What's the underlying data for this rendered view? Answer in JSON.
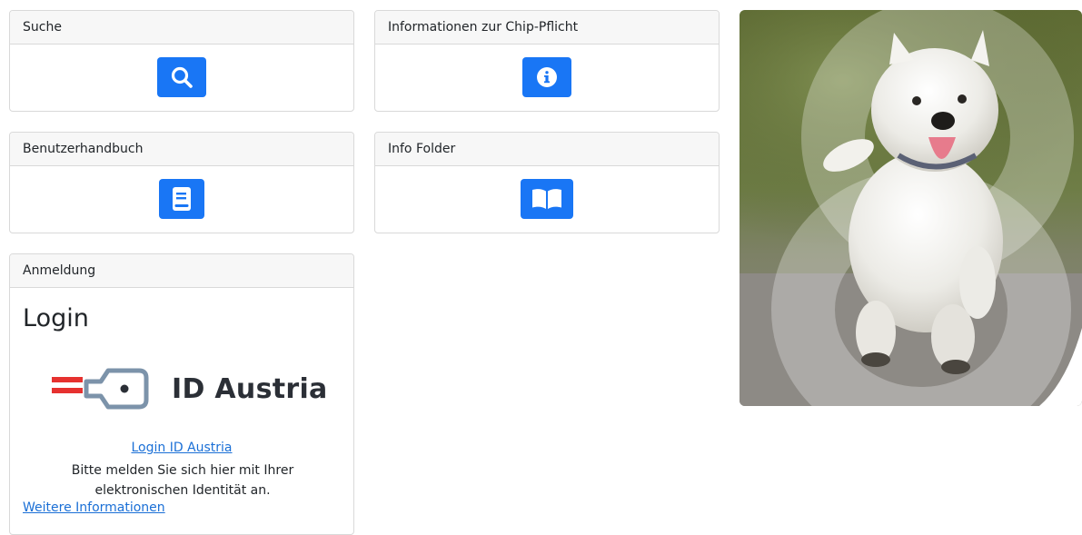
{
  "cards": {
    "search": {
      "header": "Suche",
      "icon": "search-icon"
    },
    "chip": {
      "header": "Informationen zur Chip-Pflicht",
      "icon": "info-icon"
    },
    "manual": {
      "header": "Benutzerhandbuch",
      "icon": "book-icon"
    },
    "folder": {
      "header": "Info Folder",
      "icon": "open-book-icon"
    }
  },
  "login": {
    "header": "Anmeldung",
    "title": "Login",
    "logo_text": "ID Austria",
    "link": "Login ID Austria",
    "description": "Bitte melden Sie sich hier mit Ihrer elektronischen Identität an.",
    "more_link": "Weitere Informationen"
  },
  "colors": {
    "accent": "#1976f5",
    "link": "#1a6fd6",
    "austria_red": "#e6312f"
  },
  "photo": {
    "subject": "dog-photo"
  }
}
